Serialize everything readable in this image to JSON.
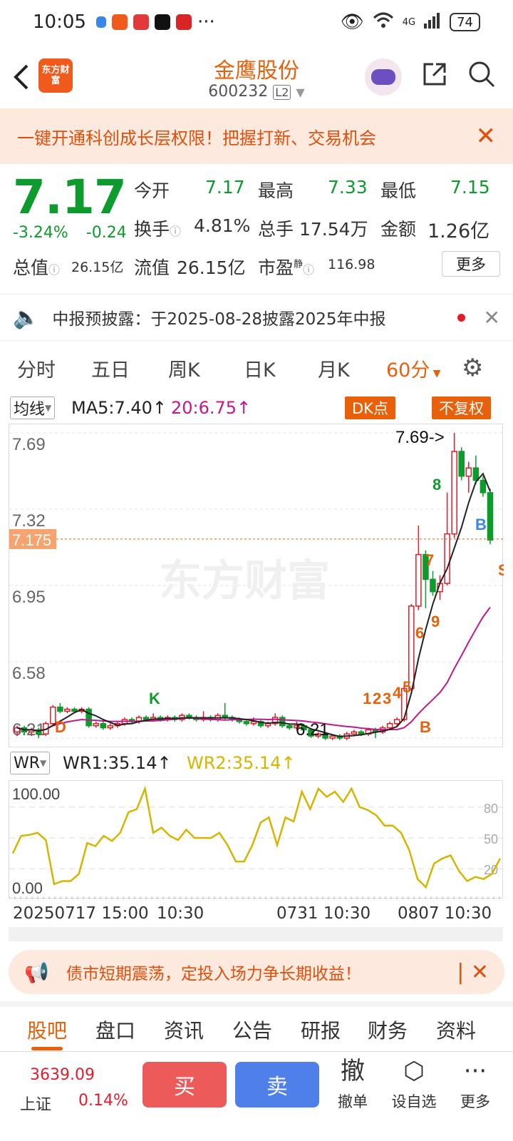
{
  "status": {
    "time": "10:05",
    "network": "4G",
    "battery": "74"
  },
  "header": {
    "logo_text": "东方财富",
    "stock_name": "金鹰股份",
    "stock_code": "600232",
    "level_badge": "L2"
  },
  "banner_top": {
    "text": "一键开通科创成长层权限！把握打新、交易机会"
  },
  "quote": {
    "price": "7.17",
    "change_pct": "-3.24%",
    "change": "-0.24",
    "open_label": "今开",
    "open": "7.17",
    "high_label": "最高",
    "high": "7.33",
    "low_label": "最低",
    "low": "7.15",
    "turnover_label": "换手",
    "turnover": "4.81%",
    "volume_label": "总手",
    "volume": "17.54万",
    "amount_label": "金额",
    "amount": "1.26亿",
    "mktcap_label": "总值",
    "mktcap": "26.15亿",
    "float_label": "流值",
    "float": "26.15亿",
    "pe_label": "市盈",
    "pe_sup": "静",
    "pe": "116.98",
    "more_label": "更多"
  },
  "notice": {
    "text": "中报预披露：于2025-08-28披露2025年中报"
  },
  "periods": [
    {
      "label": "分时"
    },
    {
      "label": "五日"
    },
    {
      "label": "周K"
    },
    {
      "label": "日K"
    },
    {
      "label": "月K"
    },
    {
      "label": "60分"
    }
  ],
  "indicator": {
    "selector": "均线",
    "ma5": "MA5:7.40↑",
    "ma20": "20:6.75↑",
    "dk_label": "DK点",
    "adjust_label": "不复权"
  },
  "chart_data": {
    "type": "candlestick",
    "y_ticks": [
      "7.69",
      "7.32",
      "6.95",
      "6.58",
      "6.21"
    ],
    "current_price_label": "7.175",
    "high_marker": "7.69->",
    "low_marker": "6.21",
    "watermark": "东方财富",
    "signals": [
      "D",
      "K",
      "1",
      "2",
      "3",
      "4",
      "5",
      "6",
      "7",
      "8",
      "9",
      "B",
      "S",
      "B",
      "D"
    ],
    "ylim": [
      6.21,
      7.69
    ],
    "candles": [
      [
        6.24,
        6.26,
        6.22,
        6.27
      ],
      [
        6.26,
        6.24,
        6.23,
        6.27
      ],
      [
        6.24,
        6.25,
        6.22,
        6.26
      ],
      [
        6.25,
        6.23,
        6.21,
        6.26
      ],
      [
        6.23,
        6.28,
        6.22,
        6.29
      ],
      [
        6.28,
        6.36,
        6.27,
        6.37
      ],
      [
        6.36,
        6.34,
        6.33,
        6.38
      ],
      [
        6.34,
        6.35,
        6.33,
        6.36
      ],
      [
        6.35,
        6.34,
        6.33,
        6.36
      ],
      [
        6.34,
        6.35,
        6.33,
        6.36
      ],
      [
        6.35,
        6.27,
        6.26,
        6.36
      ],
      [
        6.27,
        6.28,
        6.26,
        6.29
      ],
      [
        6.28,
        6.26,
        6.25,
        6.29
      ],
      [
        6.26,
        6.27,
        6.25,
        6.28
      ],
      [
        6.27,
        6.28,
        6.26,
        6.29
      ],
      [
        6.28,
        6.3,
        6.27,
        6.31
      ],
      [
        6.3,
        6.29,
        6.28,
        6.31
      ],
      [
        6.29,
        6.31,
        6.28,
        6.32
      ],
      [
        6.31,
        6.3,
        6.29,
        6.32
      ],
      [
        6.3,
        6.31,
        6.29,
        6.33
      ],
      [
        6.31,
        6.3,
        6.29,
        6.32
      ],
      [
        6.3,
        6.31,
        6.29,
        6.32
      ],
      [
        6.31,
        6.3,
        6.29,
        6.32
      ],
      [
        6.3,
        6.32,
        6.29,
        6.33
      ],
      [
        6.32,
        6.31,
        6.3,
        6.33
      ],
      [
        6.31,
        6.3,
        6.29,
        6.32
      ],
      [
        6.3,
        6.31,
        6.29,
        6.34
      ],
      [
        6.31,
        6.3,
        6.29,
        6.32
      ],
      [
        6.3,
        6.32,
        6.29,
        6.33
      ],
      [
        6.32,
        6.31,
        6.3,
        6.38
      ],
      [
        6.31,
        6.3,
        6.29,
        6.32
      ],
      [
        6.3,
        6.29,
        6.28,
        6.31
      ],
      [
        6.29,
        6.28,
        6.27,
        6.3
      ],
      [
        6.28,
        6.29,
        6.27,
        6.31
      ],
      [
        6.29,
        6.27,
        6.26,
        6.3
      ],
      [
        6.27,
        6.28,
        6.26,
        6.29
      ],
      [
        6.28,
        6.31,
        6.27,
        6.33
      ],
      [
        6.31,
        6.27,
        6.26,
        6.32
      ],
      [
        6.27,
        6.26,
        6.25,
        6.28
      ],
      [
        6.26,
        6.27,
        6.25,
        6.29
      ],
      [
        6.27,
        6.25,
        6.24,
        6.28
      ],
      [
        6.25,
        6.22,
        6.21,
        6.26
      ],
      [
        6.22,
        6.23,
        6.21,
        6.24
      ],
      [
        6.23,
        6.21,
        6.2,
        6.24
      ],
      [
        6.21,
        6.22,
        6.2,
        6.23
      ],
      [
        6.22,
        6.21,
        6.2,
        6.23
      ],
      [
        6.21,
        6.23,
        6.2,
        6.24
      ],
      [
        6.23,
        6.24,
        6.22,
        6.25
      ],
      [
        6.24,
        6.23,
        6.22,
        6.25
      ],
      [
        6.23,
        6.25,
        6.22,
        6.26
      ],
      [
        6.25,
        6.24,
        6.21,
        6.26
      ],
      [
        6.24,
        6.26,
        6.23,
        6.27
      ],
      [
        6.26,
        6.28,
        6.25,
        6.29
      ],
      [
        6.28,
        6.3,
        6.27,
        6.31
      ],
      [
        6.3,
        6.45,
        6.29,
        6.46
      ],
      [
        6.45,
        6.85,
        6.44,
        6.86
      ],
      [
        6.85,
        7.1,
        6.83,
        7.24
      ],
      [
        7.1,
        6.98,
        6.84,
        7.12
      ],
      [
        6.98,
        6.92,
        6.9,
        7.02
      ],
      [
        6.92,
        6.96,
        6.88,
        7.0
      ],
      [
        6.96,
        7.2,
        6.95,
        7.4
      ],
      [
        7.2,
        7.6,
        7.18,
        7.69
      ],
      [
        7.6,
        7.48,
        7.46,
        7.62
      ],
      [
        7.48,
        7.52,
        7.4,
        7.55
      ],
      [
        7.52,
        7.46,
        7.44,
        7.58
      ],
      [
        7.46,
        7.4,
        7.38,
        7.48
      ],
      [
        7.4,
        7.17,
        7.15,
        7.42
      ]
    ]
  },
  "wr": {
    "selector": "WR",
    "wr1": "WR1:35.14↑",
    "wr2": "WR2:35.14↑",
    "y_left_top": "100.00",
    "y_left_bottom": "0.00",
    "y_right": [
      "80",
      "50",
      "20"
    ],
    "values": [
      35,
      52,
      53,
      55,
      48,
      5,
      8,
      8,
      15,
      45,
      42,
      52,
      47,
      55,
      75,
      78,
      98,
      55,
      60,
      52,
      48,
      58,
      50,
      50,
      50,
      55,
      43,
      27,
      27,
      43,
      65,
      70,
      43,
      70,
      66,
      95,
      78,
      98,
      90,
      95,
      85,
      98,
      80,
      77,
      72,
      62,
      62,
      55,
      38,
      10,
      2,
      25,
      30,
      33,
      18,
      8,
      12,
      10,
      15,
      30
    ]
  },
  "time_axis": [
    "20250717 15:00",
    "10:30",
    "0731 10:30",
    "0807 10:30"
  ],
  "banner_bottom": {
    "text": "债市短期震荡，定投入场力争长期收益！"
  },
  "tabs": [
    {
      "label": "股吧"
    },
    {
      "label": "盘口"
    },
    {
      "label": "资讯"
    },
    {
      "label": "公告"
    },
    {
      "label": "研报"
    },
    {
      "label": "财务"
    },
    {
      "label": "资料"
    }
  ],
  "bottom": {
    "index_value": "3639.09",
    "index_name": "上证",
    "index_pct": "0.14%",
    "buy": "买",
    "sell": "卖",
    "cancel_icon": "撤",
    "cancel_label": "撤单",
    "watch_label": "设自选",
    "more_label": "更多"
  },
  "colors": {
    "accent": "#e8600a",
    "up": "#e21c2b",
    "down": "#0e9b2d",
    "ma20": "#c2188d",
    "wr": "#d6b400"
  }
}
